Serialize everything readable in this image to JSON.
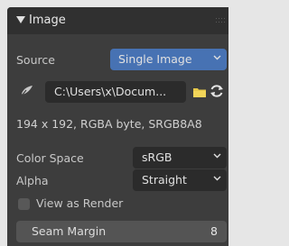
{
  "panel": {
    "title": "Image",
    "source": {
      "label": "Source",
      "value": "Single Image"
    },
    "filepath": {
      "value": "C:\\Users\\x\\Docum..."
    },
    "image_info": "194 x 192,  RGBA byte,  SRGB8A8",
    "color_space": {
      "label": "Color Space",
      "value": "sRGB"
    },
    "alpha": {
      "label": "Alpha",
      "value": "Straight"
    },
    "view_as_render": {
      "label": "View as Render",
      "checked": false
    },
    "seam_margin": {
      "label": "Seam Margin",
      "value": "8"
    }
  },
  "colors": {
    "panel_bg": "#3d3d3d",
    "header_bg": "#303030",
    "field_bg": "#2b2b2b",
    "accent_blue": "#4772b3",
    "folder_yellow": "#e8c94a"
  },
  "icons": [
    "panel-collapse-triangle-icon",
    "image-data-icon",
    "folder-icon",
    "reload-icon",
    "chevron-down-icon"
  ]
}
